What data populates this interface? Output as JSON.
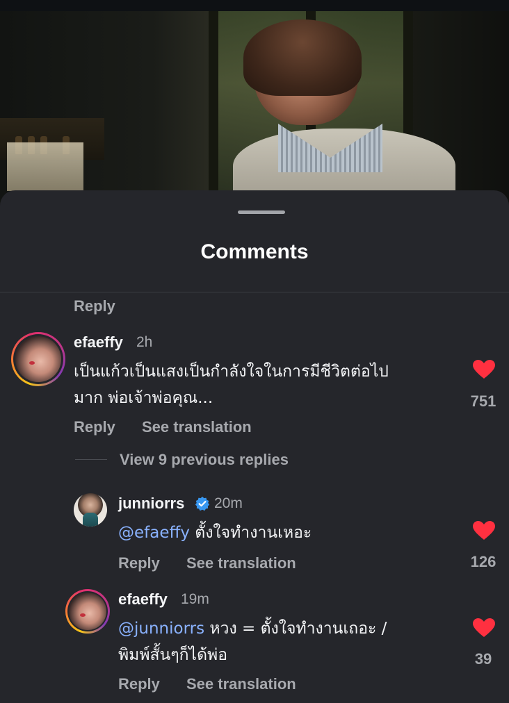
{
  "sheet": {
    "title": "Comments"
  },
  "top_reply_label": "Reply",
  "comments": [
    {
      "username": "efaeffy",
      "time": "2h",
      "text_line1": "เป็นแก้วเป็นแสงเป็นกำลังใจในการมีชีวิตต่อไป",
      "text_line2": "มาก พ่อเจ้าพ่อคุณ...",
      "likes": "751",
      "reply_label": "Reply",
      "translate_label": "See translation",
      "view_replies_label": "View 9 previous replies"
    }
  ],
  "replies": [
    {
      "username": "junniorrs",
      "verified": true,
      "time": "20m",
      "mention": "@efaeffy",
      "text": " ตั้งใจทำงานเหอะ",
      "likes": "126",
      "reply_label": "Reply",
      "translate_label": "See translation"
    },
    {
      "username": "efaeffy",
      "time": "19m",
      "mention": "@junniorrs",
      "text_line1_rest": "  หวง = ตั้งใจทำงานเถอะ /",
      "text_line2": "พิมพ์สั้นๆก็ได้พ่อ",
      "likes": "39",
      "reply_label": "Reply",
      "translate_label": "See translation"
    }
  ],
  "colors": {
    "sheet_bg": "#25262b",
    "heart": "#ff3040",
    "mention": "#8ab2ff",
    "verified": "#3897f0",
    "muted_text": "#a7a9ae"
  }
}
